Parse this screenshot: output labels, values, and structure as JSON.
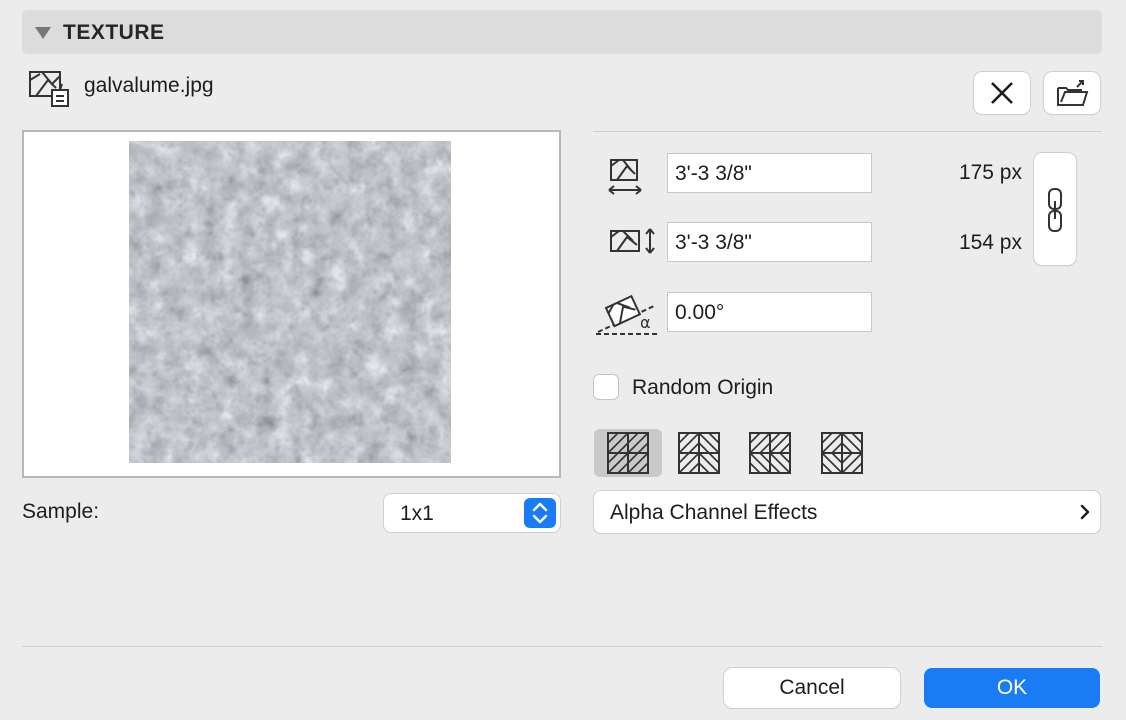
{
  "section": {
    "title": "TEXTURE"
  },
  "file": {
    "name": "galvalume.jpg"
  },
  "toolbar": {
    "remove_icon": "close-icon",
    "open_icon": "folder-open-icon"
  },
  "texture": {
    "width_value": "3'-3 3/8\"",
    "width_px": "175 px",
    "height_value": "3'-3 3/8\"",
    "height_px": "154 px",
    "angle_value": "0.00°",
    "link_icon": "chain-link-icon"
  },
  "random_origin": {
    "label": "Random Origin",
    "checked": false
  },
  "mirror_modes": [
    {
      "icon": "mirror-none-icon",
      "selected": true
    },
    {
      "icon": "mirror-x-icon",
      "selected": false
    },
    {
      "icon": "mirror-y-icon",
      "selected": false
    },
    {
      "icon": "mirror-xy-icon",
      "selected": false
    }
  ],
  "sample": {
    "label": "Sample:",
    "value": "1x1"
  },
  "alpha": {
    "label": "Alpha Channel Effects"
  },
  "footer": {
    "cancel_label": "Cancel",
    "ok_label": "OK"
  },
  "colors": {
    "accent": "#1a7cf5",
    "background": "#ececec",
    "header": "#dcdcdc"
  }
}
